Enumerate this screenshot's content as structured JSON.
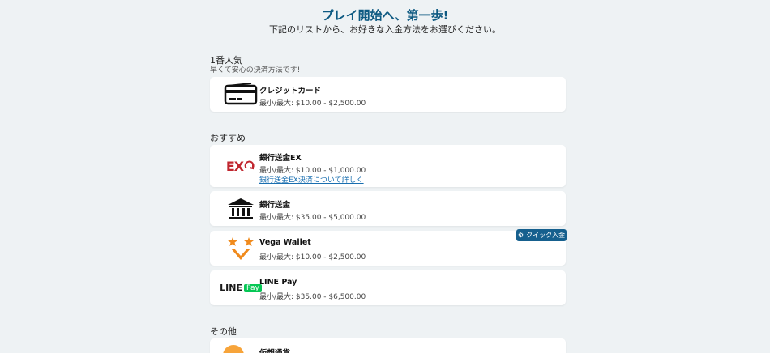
{
  "header": {
    "title": "プレイ開始へ、第一歩!",
    "subtitle": "下記のリストから、お好きな入金方法をお選びください。"
  },
  "sections": [
    {
      "title": "1番人気",
      "subtitle": "早くて安心の決済方法です!"
    },
    {
      "title": "おすすめ"
    },
    {
      "title": "その他"
    }
  ],
  "methods": {
    "credit_card": {
      "name": "クレジットカード",
      "limits": "最小/最大: $10.00 - $2,500.00",
      "icon": "credit-card-icon"
    },
    "bank_ex": {
      "name": "銀行送金EX",
      "limits": "最小/最大: $10.00 - $1,000.00",
      "link": "銀行送金EX決済について詳しく",
      "logo_text": "EX",
      "icon": "bank-transfer-ex-logo"
    },
    "bank": {
      "name": "銀行送金",
      "limits": "最小/最大: $35.00 - $5,000.00",
      "icon": "bank-icon"
    },
    "vega": {
      "name": "Vega Wallet",
      "limits": "最小/最大: $10.00 - $2,500.00",
      "icon": "vega-wallet-logo",
      "badge": "クイック入金"
    },
    "linepay": {
      "name": "LINE Pay",
      "limits": "最小/最大: $35.00 - $6,500.00",
      "logo_line": "LINE",
      "logo_pay": "Pay",
      "icon": "line-pay-logo"
    },
    "crypto": {
      "name": "仮想通貨",
      "icon": "crypto-coin-icon"
    }
  },
  "colors": {
    "accent": "#0e5a82",
    "badge": "#16608e",
    "line_green": "#06c755",
    "vega_orange": "#f08a1c"
  }
}
